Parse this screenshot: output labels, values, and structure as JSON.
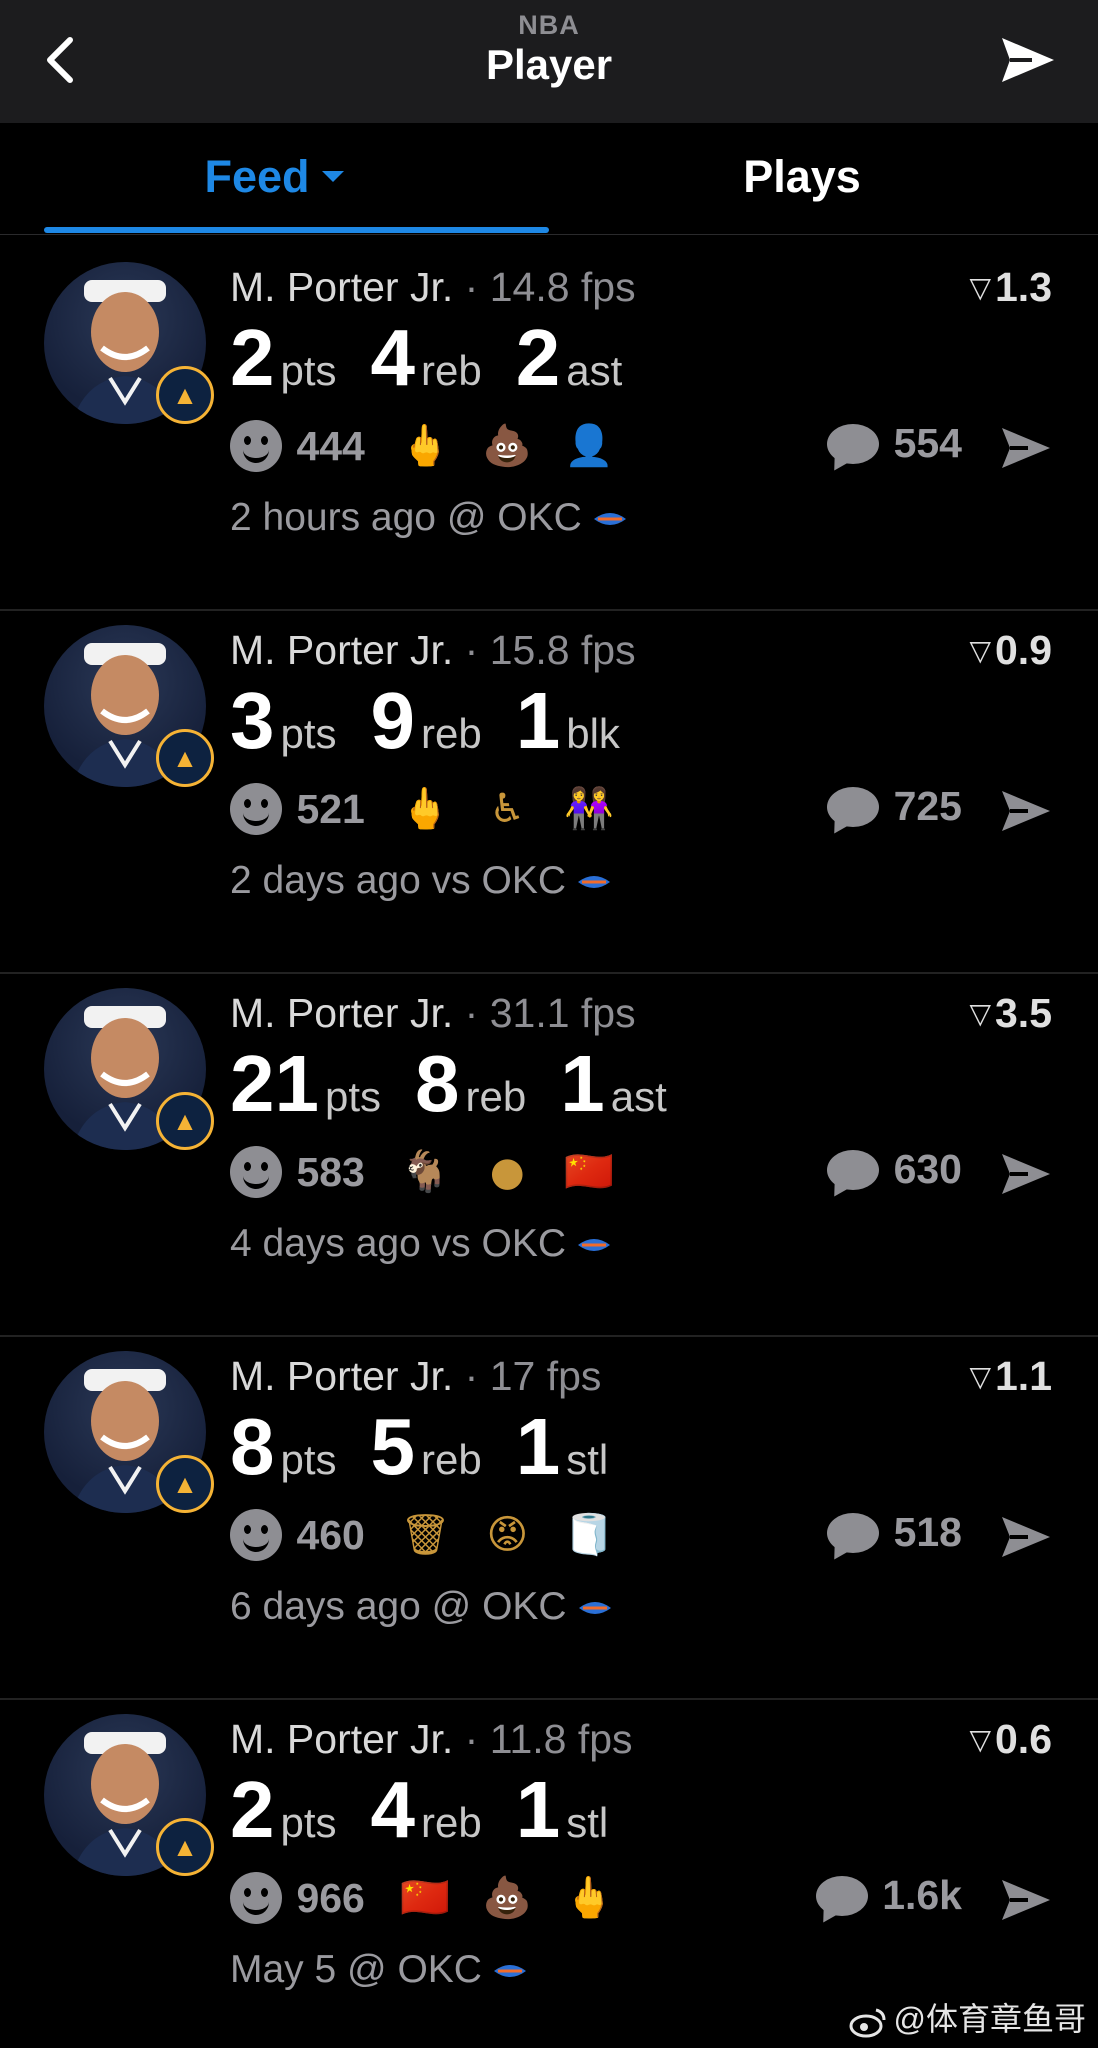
{
  "header": {
    "league": "NBA",
    "title": "Player"
  },
  "tabs": [
    {
      "label": "Feed",
      "active": true
    },
    {
      "label": "Plays",
      "active": false
    }
  ],
  "colors": {
    "accent": "#1e88e5",
    "muted": "#8e8e93",
    "badge": "#f5b335"
  },
  "feed": [
    {
      "player": "M. Porter Jr.",
      "fps": "· 14.8 fps",
      "rating": "1.3",
      "stats": [
        {
          "value": "2",
          "label": "pts"
        },
        {
          "value": "4",
          "label": "reb"
        },
        {
          "value": "2",
          "label": "ast"
        }
      ],
      "reaction_count": "444",
      "emojis": [
        "middle-finger",
        "poo",
        "man-in-suit"
      ],
      "emoji_glyphs": [
        "🖕",
        "💩",
        "👤"
      ],
      "comment_count": "554",
      "meta": "2 hours ago @ OKC"
    },
    {
      "player": "M. Porter Jr.",
      "fps": "· 15.8 fps",
      "rating": "0.9",
      "stats": [
        {
          "value": "3",
          "label": "pts"
        },
        {
          "value": "9",
          "label": "reb"
        },
        {
          "value": "1",
          "label": "blk"
        }
      ],
      "reaction_count": "521",
      "emojis": [
        "middle-finger",
        "wheelchair",
        "women-holding-hands"
      ],
      "emoji_glyphs": [
        "🖕",
        "♿",
        "👭"
      ],
      "comment_count": "725",
      "meta": "2 days ago vs OKC"
    },
    {
      "player": "M. Porter Jr.",
      "fps": "· 31.1 fps",
      "rating": "3.5",
      "stats": [
        {
          "value": "21",
          "label": "pts"
        },
        {
          "value": "8",
          "label": "reb"
        },
        {
          "value": "1",
          "label": "ast"
        }
      ],
      "reaction_count": "583",
      "emojis": [
        "goat",
        "grey-circle",
        "china-flag"
      ],
      "emoji_glyphs": [
        "🐐",
        "●",
        "🇨🇳"
      ],
      "comment_count": "630",
      "meta": "4 days ago vs OKC"
    },
    {
      "player": "M. Porter Jr.",
      "fps": "· 17 fps",
      "rating": "1.1",
      "stats": [
        {
          "value": "8",
          "label": "pts"
        },
        {
          "value": "5",
          "label": "reb"
        },
        {
          "value": "1",
          "label": "stl"
        }
      ],
      "reaction_count": "460",
      "emojis": [
        "basketball-net",
        "cursing-face",
        "toilet-paper"
      ],
      "emoji_glyphs": [
        "🗑",
        "😡",
        "🧻"
      ],
      "comment_count": "518",
      "meta": "6 days ago @ OKC"
    },
    {
      "player": "M. Porter Jr.",
      "fps": "· 11.8 fps",
      "rating": "0.6",
      "stats": [
        {
          "value": "2",
          "label": "pts"
        },
        {
          "value": "4",
          "label": "reb"
        },
        {
          "value": "1",
          "label": "stl"
        }
      ],
      "reaction_count": "966",
      "emojis": [
        "china-flag",
        "poo",
        "middle-finger"
      ],
      "emoji_glyphs": [
        "🇨🇳",
        "💩",
        "🖕"
      ],
      "comment_count": "1.6k",
      "meta": "May 5 @ OKC"
    }
  ],
  "watermark": "@体育章鱼哥"
}
